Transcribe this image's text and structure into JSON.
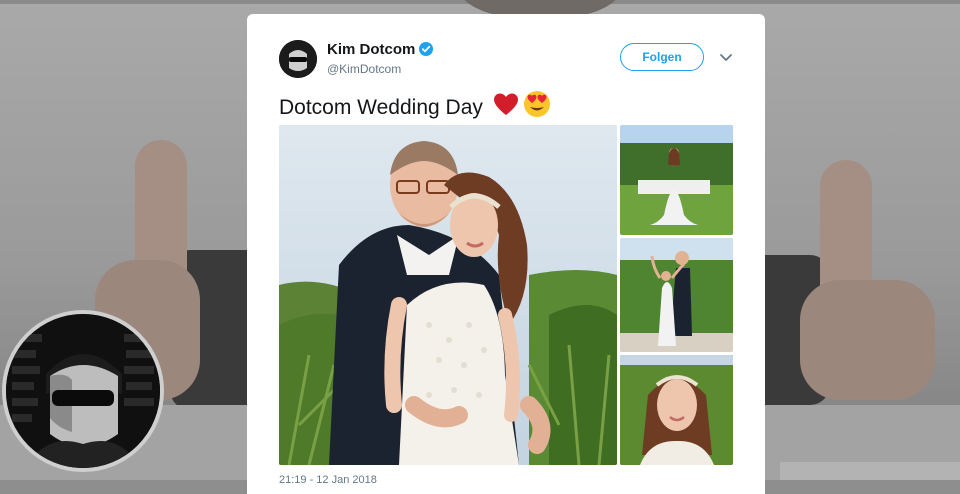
{
  "tweet": {
    "display_name": "Kim Dotcom",
    "handle": "@KimDotcom",
    "follow_label": "Folgen",
    "text": "Dotcom Wedding Day",
    "emojis": [
      "red-heart",
      "heart-eyes-face"
    ],
    "timestamp": "21:19 - 12 Jan 2018"
  },
  "colors": {
    "accent": "#1da1f2",
    "verified": "#1da1f2",
    "text_primary": "#14171a",
    "text_secondary": "#657786"
  },
  "icons": [
    "verified-badge-icon",
    "chevron-down-icon"
  ]
}
